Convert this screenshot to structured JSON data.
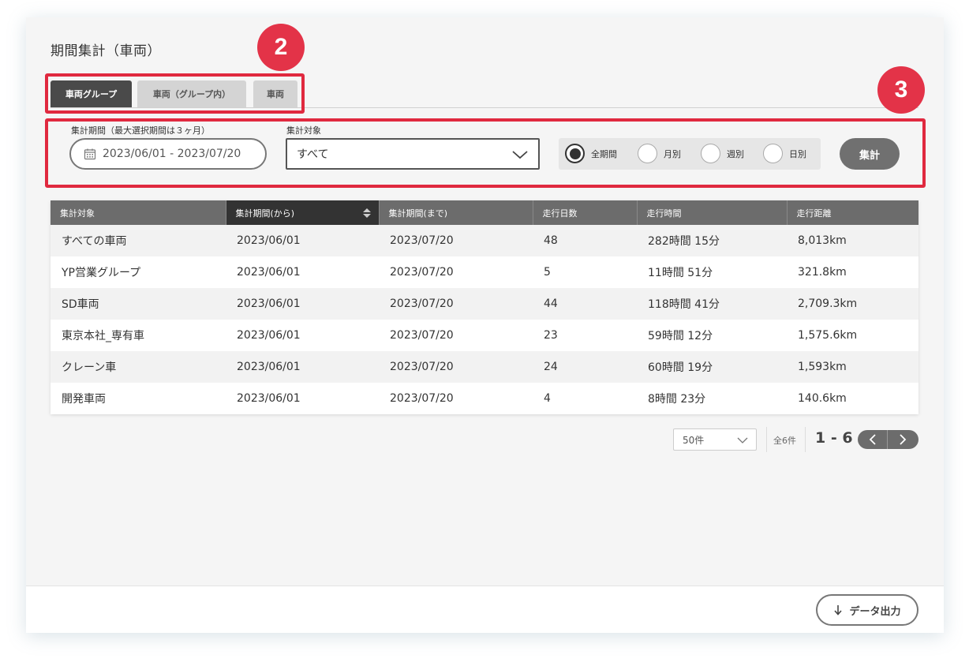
{
  "page": {
    "title": "期間集計（車両）"
  },
  "tabs": [
    {
      "label": "車両グループ",
      "active": true
    },
    {
      "label": "車両（グループ内）",
      "active": false
    },
    {
      "label": "車両",
      "active": false
    }
  ],
  "annotations": {
    "badge_2": "2",
    "badge_3": "3",
    "highlight_color": "#e0293f"
  },
  "filters": {
    "period_label": "集計期間（最大選択期間は３ヶ月）",
    "period_value": "2023/06/01 - 2023/07/20",
    "target_label": "集計対象",
    "target_value": "すべて",
    "granularity": [
      {
        "label": "全期間",
        "checked": true
      },
      {
        "label": "月別",
        "checked": false
      },
      {
        "label": "週別",
        "checked": false
      },
      {
        "label": "日別",
        "checked": false
      }
    ],
    "aggregate_button": "集計"
  },
  "table": {
    "columns": [
      "集計対象",
      "集計期間(から)",
      "集計期間(まで)",
      "走行日数",
      "走行時間",
      "走行距離"
    ],
    "sorted_column": 1,
    "rows": [
      [
        "すべての車両",
        "2023/06/01",
        "2023/07/20",
        "48",
        "282時間 15分",
        "8,013km"
      ],
      [
        "YP営業グループ",
        "2023/06/01",
        "2023/07/20",
        "5",
        "11時間 51分",
        "321.8km"
      ],
      [
        "SD車両",
        "2023/06/01",
        "2023/07/20",
        "44",
        "118時間 41分",
        "2,709.3km"
      ],
      [
        "東京本社_専有車",
        "2023/06/01",
        "2023/07/20",
        "23",
        "59時間 12分",
        "1,575.6km"
      ],
      [
        "クレーン車",
        "2023/06/01",
        "2023/07/20",
        "24",
        "60時間 19分",
        "1,593km"
      ],
      [
        "開発車両",
        "2023/06/01",
        "2023/07/20",
        "4",
        "8時間 23分",
        "140.6km"
      ]
    ]
  },
  "pagination": {
    "per_page": "50件",
    "total": "全6件",
    "range": "1 - 6"
  },
  "footer": {
    "export_button": "データ出力"
  }
}
